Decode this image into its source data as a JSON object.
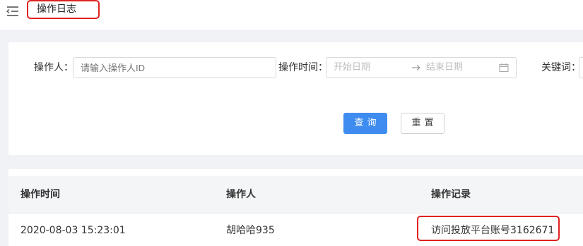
{
  "header": {
    "title": "操作日志"
  },
  "filters": {
    "operator_label": "操作人",
    "operator_placeholder": "请输入操作人ID",
    "time_label": "操作时间",
    "start_placeholder": "开始日期",
    "end_placeholder": "结束日期",
    "keyword_label": "关键词"
  },
  "buttons": {
    "search": "查询",
    "reset": "重置"
  },
  "table": {
    "columns": [
      "操作时间",
      "操作人",
      "操作记录"
    ],
    "rows": [
      [
        "2020-08-03 15:23:01",
        "胡哈哈935",
        "访问投放平台账号3162671"
      ]
    ]
  },
  "colors": {
    "primary": "#3f8cf0",
    "highlight": "#e02020"
  }
}
